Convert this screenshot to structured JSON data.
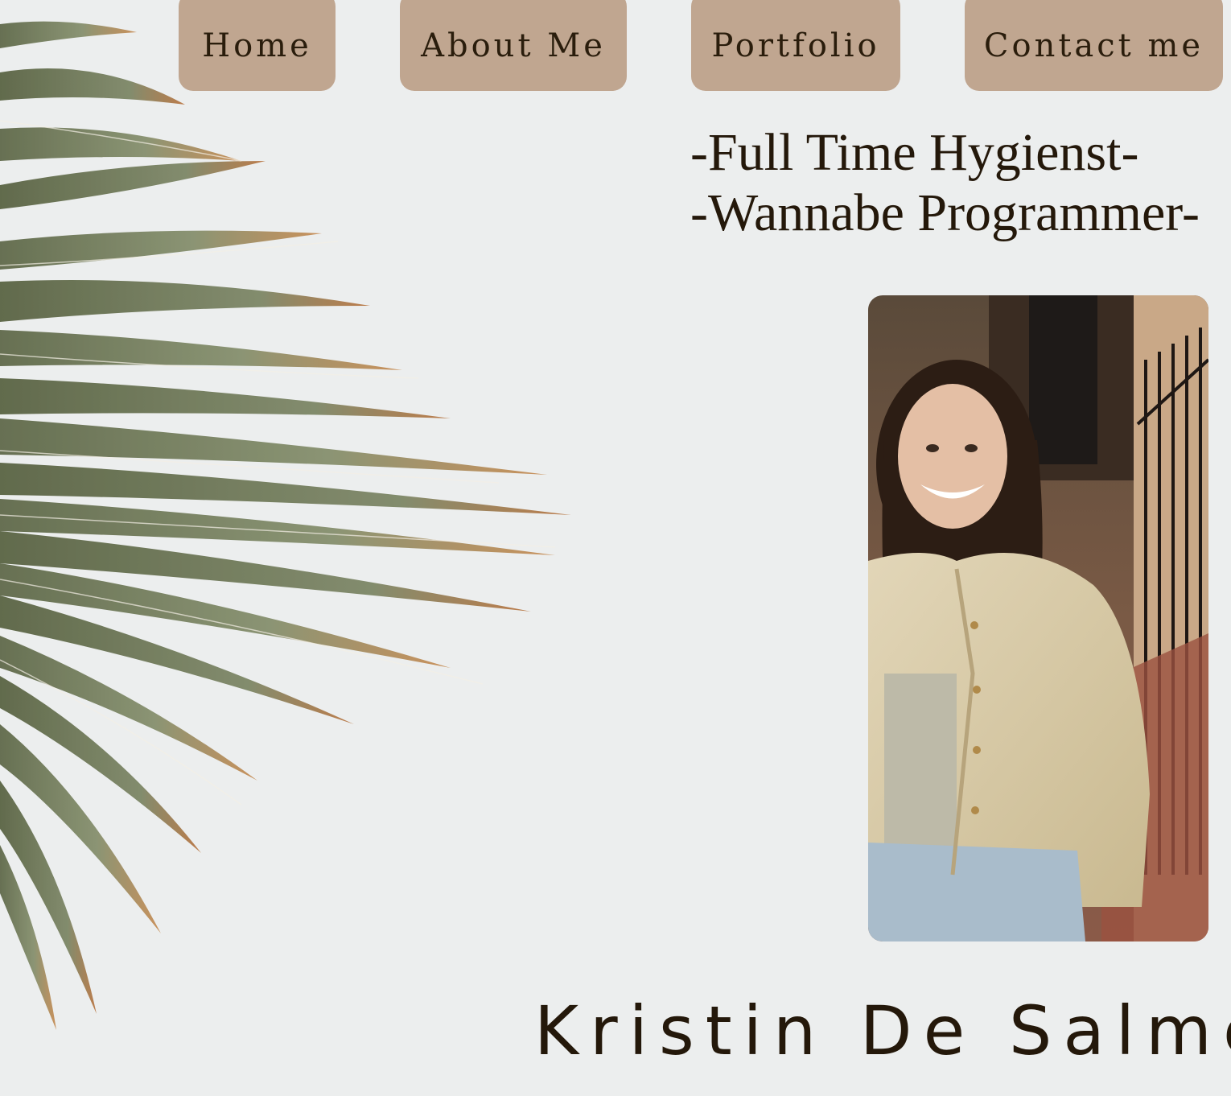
{
  "nav": {
    "items": [
      {
        "label": "Home"
      },
      {
        "label": "About Me"
      },
      {
        "label": "Portfolio"
      },
      {
        "label": "Contact me"
      }
    ]
  },
  "hero": {
    "tagline_line1": "-Full Time Hygienst-",
    "tagline_line2": "-Wannabe Programmer-",
    "name": "Kristin De Salme"
  },
  "colors": {
    "background": "#eceeee",
    "nav_button": "#c0a690",
    "text": "#24180a",
    "leaf_green": "#6b7757",
    "leaf_tip": "#b9733e"
  }
}
